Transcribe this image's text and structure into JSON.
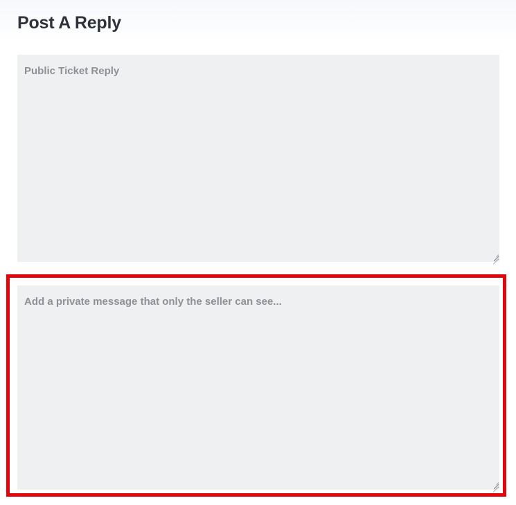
{
  "page": {
    "title": "Post A Reply",
    "background_color": "#ffffff",
    "gradient_top_color": "#f6f8fc"
  },
  "form": {
    "public_reply": {
      "name": "public-ticket-reply",
      "placeholder": "Public Ticket Reply",
      "value": "",
      "field_background": "#eff0f2",
      "placeholder_color": "#8d9095",
      "resizable": true,
      "resize_handle_icon": "resize-grip-icon"
    },
    "private_note": {
      "name": "private-seller-note",
      "placeholder": "Add a private message that only the seller can see...",
      "value": "",
      "field_background": "#eff0f2",
      "placeholder_color": "#8d9095",
      "resizable": true,
      "resize_handle_icon": "resize-grip-icon",
      "highlighted": true,
      "highlight_color": "#e2050a"
    }
  }
}
